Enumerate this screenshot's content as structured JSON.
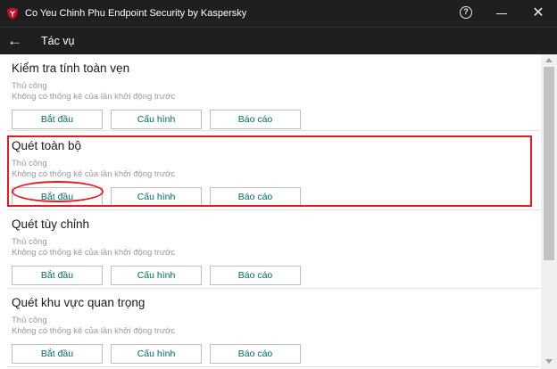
{
  "window": {
    "title": "Co Yeu Chinh Phu Endpoint Security by Kaspersky",
    "help_label": "?",
    "close_label": "✕"
  },
  "header": {
    "back_label": "←",
    "title": "Tác vụ"
  },
  "tasks": [
    {
      "name": "Kiểm tra tính toàn vẹn",
      "mode": "Thủ công",
      "status": "Không có thống kê của lần khởi động trước",
      "start_label": "Bắt đầu",
      "settings_label": "Cấu hình",
      "report_label": "Báo cáo"
    },
    {
      "name": "Quét toàn bộ",
      "mode": "Thủ công",
      "status": "Không có thống kê của lần khởi động trước",
      "start_label": "Bắt đầu",
      "settings_label": "Cấu hình",
      "report_label": "Báo cáo"
    },
    {
      "name": "Quét tùy chỉnh",
      "mode": "Thủ công",
      "status": "Không có thống kê của lần khởi động trước",
      "start_label": "Bắt đầu",
      "settings_label": "Cấu hình",
      "report_label": "Báo cáo"
    },
    {
      "name": "Quét khu vực quan trọng",
      "mode": "Thủ công",
      "status": "Không có thống kê của lần khởi động trước",
      "start_label": "Bắt đầu",
      "settings_label": "Cấu hình",
      "report_label": "Báo cáo"
    }
  ],
  "colors": {
    "titlebar_bg": "#1f1f1f",
    "button_text": "#006d5b",
    "highlight": "#e31b23",
    "brand_icon": "#c8102e"
  },
  "icons": {
    "app": "kaspersky-shield-icon",
    "help": "help-icon",
    "minimize": "minimize-icon",
    "close": "close-icon",
    "back": "back-arrow-icon"
  }
}
